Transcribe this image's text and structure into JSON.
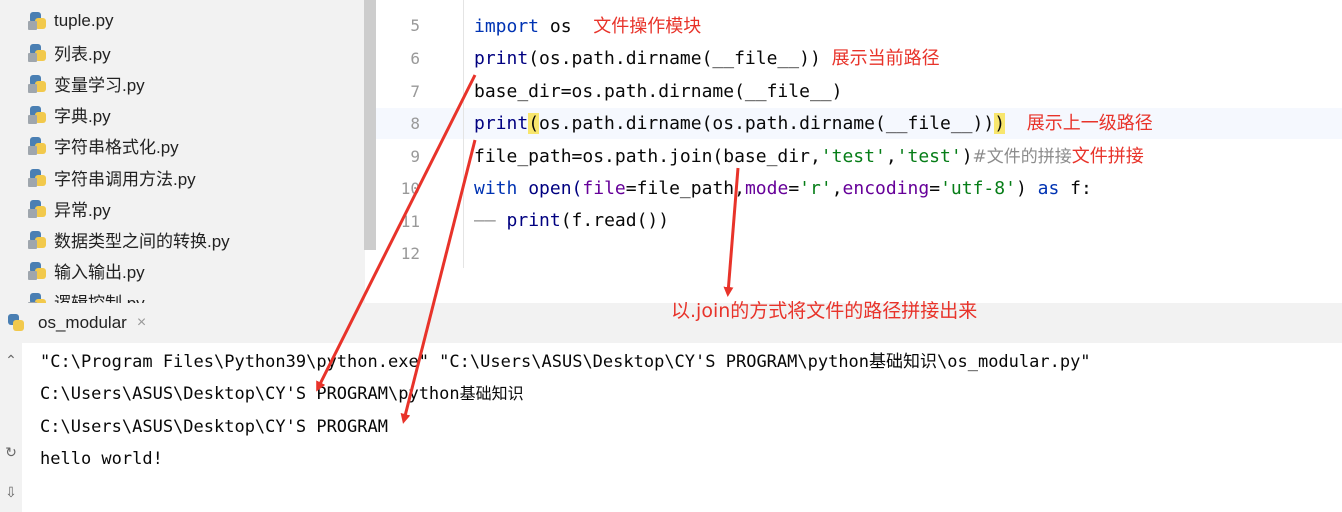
{
  "project_tree": {
    "files": [
      "tuple.py",
      "列表.py",
      "变量学习.py",
      "字典.py",
      "字符串格式化.py",
      "字符串调用方法.py",
      "异常.py",
      "数据类型之间的转换.py",
      "输入输出.py",
      "逻辑控制.py"
    ]
  },
  "editor": {
    "line_numbers": [
      "5",
      "6",
      "7",
      "8",
      "9",
      "10",
      "11",
      "12"
    ],
    "line5": {
      "kw": "import",
      "rest": " os",
      "note": "文件操作模块"
    },
    "line6": {
      "fn": "print",
      "rest": "(os.path.dirname(__file__))",
      "note": "展示当前路径"
    },
    "line7": {
      "code": "base_dir=os.path.dirname(__file__)"
    },
    "line8": {
      "fn": "print",
      "open": "(",
      "mid": "os.path.dirname(os.path.dirname(__file__))",
      "close": ")",
      "note": "展示上一级路径"
    },
    "line9": {
      "a": "file_path=os.path.join(base_dir,",
      "s1": "'test'",
      "c": ",",
      "s2": "'test'",
      "d": ")",
      "comment": "#文件的拼接",
      "note": "文件拼接"
    },
    "line10": {
      "kw": "with",
      "open_fn": " open(",
      "p1": "file",
      "a": "=file_path,",
      "p2": "mode",
      "b": "=",
      "s1": "'r'",
      "c": ",",
      "p3": "encoding",
      "d": "=",
      "s2": "'utf-8'",
      "e": ") ",
      "kw2": "as",
      "f": " f:"
    },
    "line11": {
      "indent": "——",
      "fn": " print",
      "rest": "(f.read())"
    }
  },
  "run_tab": {
    "label": "os_modular",
    "close": "×"
  },
  "callout": "以.join的方式将文件的路径拼接出来",
  "console": {
    "line1": "\"C:\\Program Files\\Python39\\python.exe\" \"C:\\Users\\ASUS\\Desktop\\CY'S PROGRAM\\python基础知识\\os_modular.py\"",
    "line2_prefix": "C:\\Users\\ASUS\\Desktop\\CY'S PROGRAM\\python",
    "line2_cjk": "基础知识",
    "line3": "C:\\Users\\ASUS\\Desktop\\CY'S PROGRAM",
    "line4": "hello world!"
  },
  "colors": {
    "annotation": "#e8332a",
    "keyword": "#0033b3",
    "string": "#067d17",
    "param": "#660099"
  }
}
